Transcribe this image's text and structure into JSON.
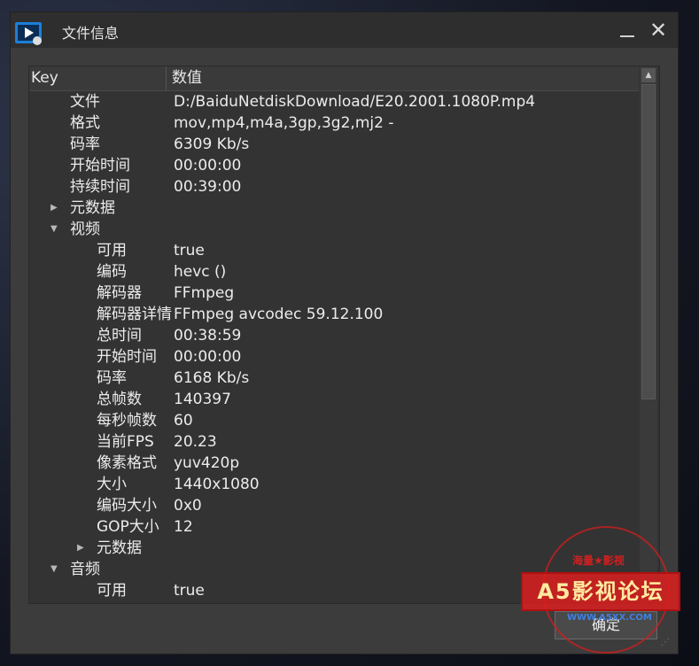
{
  "window": {
    "title": "文件信息"
  },
  "table": {
    "headers": {
      "key": "Key",
      "value": "数值"
    },
    "rows": [
      {
        "key": "文件",
        "value": "D:/BaiduNetdiskDownload/E20.2001.1080P.mp4",
        "level": 1,
        "expander": ""
      },
      {
        "key": "格式",
        "value": "mov,mp4,m4a,3gp,3g2,mj2 -",
        "level": 1,
        "expander": ""
      },
      {
        "key": "码率",
        "value": "6309 Kb/s",
        "level": 1,
        "expander": ""
      },
      {
        "key": "开始时间",
        "value": "00:00:00",
        "level": 1,
        "expander": ""
      },
      {
        "key": "持续时间",
        "value": "00:39:00",
        "level": 1,
        "expander": ""
      },
      {
        "key": "元数据",
        "value": "",
        "level": 1,
        "expander": "collapsed"
      },
      {
        "key": "视频",
        "value": "",
        "level": 1,
        "expander": "expanded"
      },
      {
        "key": "可用",
        "value": "true",
        "level": 2,
        "expander": ""
      },
      {
        "key": "编码",
        "value": "hevc ()",
        "level": 2,
        "expander": ""
      },
      {
        "key": "解码器",
        "value": "FFmpeg",
        "level": 2,
        "expander": ""
      },
      {
        "key": "解码器详情",
        "value": "FFmpeg avcodec 59.12.100",
        "level": 2,
        "expander": ""
      },
      {
        "key": "总时间",
        "value": "00:38:59",
        "level": 2,
        "expander": ""
      },
      {
        "key": "开始时间",
        "value": "00:00:00",
        "level": 2,
        "expander": ""
      },
      {
        "key": "码率",
        "value": "6168 Kb/s",
        "level": 2,
        "expander": ""
      },
      {
        "key": "总帧数",
        "value": "140397",
        "level": 2,
        "expander": ""
      },
      {
        "key": "每秒帧数",
        "value": "60",
        "level": 2,
        "expander": ""
      },
      {
        "key": "当前FPS",
        "value": "20.23",
        "level": 2,
        "expander": ""
      },
      {
        "key": "像素格式",
        "value": "yuv420p",
        "level": 2,
        "expander": ""
      },
      {
        "key": "大小",
        "value": "1440x1080",
        "level": 2,
        "expander": ""
      },
      {
        "key": "编码大小",
        "value": "0x0",
        "level": 2,
        "expander": ""
      },
      {
        "key": "GOP大小",
        "value": "12",
        "level": 2,
        "expander": ""
      },
      {
        "key": "元数据",
        "value": "",
        "level": 2,
        "expander": "collapsed"
      },
      {
        "key": "音频",
        "value": "",
        "level": 1,
        "expander": "expanded"
      },
      {
        "key": "可用",
        "value": "true",
        "level": 2,
        "expander": ""
      }
    ]
  },
  "footer": {
    "ok_label": "确定"
  },
  "watermark": {
    "top_text": "海量★影视",
    "band_text": "A5影视论坛",
    "url_text": "WWW.A5XX.COM"
  }
}
